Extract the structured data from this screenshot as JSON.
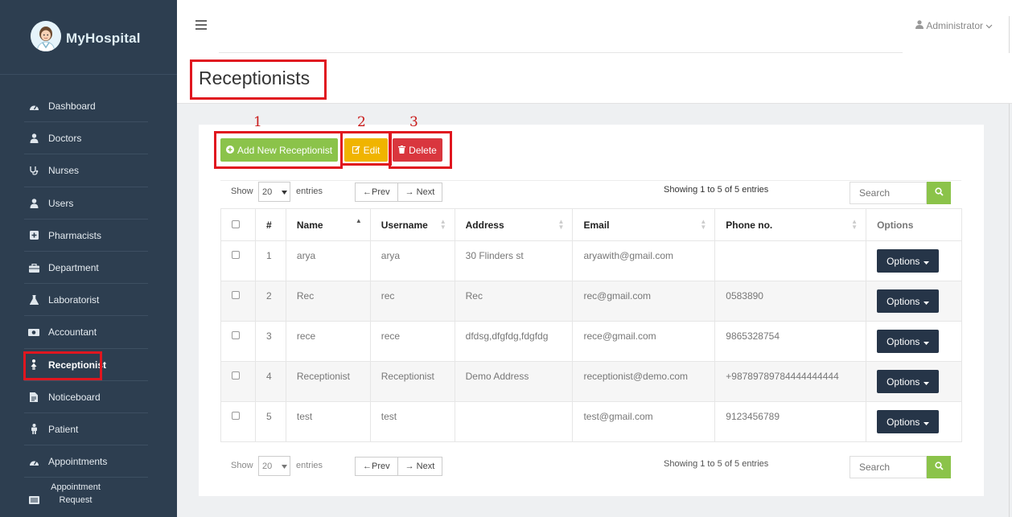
{
  "app": {
    "logo_text": "MyHospital",
    "logo_icon": "doctor-avatar-icon"
  },
  "sidebar": {
    "items": [
      {
        "label": "Dashboard",
        "icon": "dashboard-icon"
      },
      {
        "label": "Doctors",
        "icon": "user-md-icon"
      },
      {
        "label": "Nurses",
        "icon": "stethoscope-icon"
      },
      {
        "label": "Users",
        "icon": "user-icon"
      },
      {
        "label": "Pharmacists",
        "icon": "plus-square-icon"
      },
      {
        "label": "Department",
        "icon": "briefcase-icon"
      },
      {
        "label": "Laboratorist",
        "icon": "flask-icon"
      },
      {
        "label": "Accountant",
        "icon": "money-icon"
      },
      {
        "label": "Receptionist",
        "icon": "female-icon",
        "active": true
      },
      {
        "label": "Noticeboard",
        "icon": "file-icon"
      },
      {
        "label": "Patient",
        "icon": "male-icon"
      },
      {
        "label": "Appointments",
        "icon": "dashboard-icon"
      },
      {
        "label": "Appointment Request",
        "icon": "list-icon"
      }
    ]
  },
  "header": {
    "user_label": "Administrator"
  },
  "page": {
    "title": "Receptionists"
  },
  "annotations": {
    "n1": "1",
    "n2": "2",
    "n3": "3"
  },
  "toolbar": {
    "add_label": "Add New Receptionist",
    "edit_label": "Edit",
    "delete_label": "Delete"
  },
  "datatable": {
    "show_label": "Show",
    "page_size": "20",
    "entries_label": "entries",
    "prev_label": "←Prev",
    "next_label": "→ Next",
    "info": "Showing 1 to 5 of 5 entries",
    "search_placeholder": "Search"
  },
  "table": {
    "columns": [
      "#",
      "Name",
      "Username",
      "Address",
      "Email",
      "Phone no.",
      "Options"
    ],
    "rows": [
      {
        "id": "1",
        "name": "arya",
        "username": "arya",
        "address": "30 Flinders st",
        "email": "aryawith@gmail.com",
        "phone": ""
      },
      {
        "id": "2",
        "name": "Rec",
        "username": "rec",
        "address": "Rec",
        "email": "rec@gmail.com",
        "phone": "0583890"
      },
      {
        "id": "3",
        "name": "rece",
        "username": "rece",
        "address": "dfdsg,dfgfdg,fdgfdg",
        "email": "rece@gmail.com",
        "phone": "9865328754"
      },
      {
        "id": "4",
        "name": "Receptionist",
        "username": "Receptionist",
        "address": "Demo Address",
        "email": "receptionist@demo.com",
        "phone": "+98789789784444444444"
      },
      {
        "id": "5",
        "name": "test",
        "username": "test",
        "address": "",
        "email": "test@gmail.com",
        "phone": "9123456789"
      }
    ],
    "options_label": "Options"
  },
  "colors": {
    "sidebar_bg": "#2d3e50",
    "add_green": "#8bc34a",
    "edit_yellow": "#f0b400",
    "delete_red": "#d9363e",
    "highlight_red": "#e0161f"
  }
}
